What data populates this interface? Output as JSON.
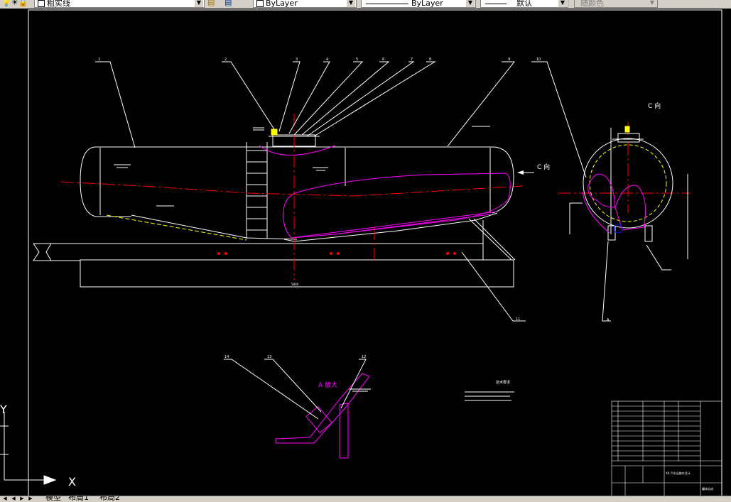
{
  "toolbar": {
    "layer_name": "粗实线",
    "color": "ByLayer",
    "linetype": "ByLayer",
    "lineweight": "默认",
    "plotstyle": "随颜色"
  },
  "drawing": {
    "balloons": [
      "1",
      "2",
      "3",
      "4",
      "5",
      "6",
      "7",
      "8",
      "9",
      "10",
      "11",
      "12",
      "13",
      "14"
    ],
    "view_label": "C 向",
    "view_arrow": "C 向",
    "detail_label": "A",
    "section_label": "A",
    "detail_title": "A 放大",
    "notes_title": "技术要求",
    "ucs_x": "X",
    "ucs_y": "Y",
    "title_block_company": "XX 汽车运输车设计",
    "title_block_name": "罐体总成"
  },
  "tabs": {
    "model": "模型",
    "layout1": "布局1",
    "layout2": "布局2"
  },
  "colors": {
    "canvas": "#000000",
    "line_white": "#ffffff",
    "center_red": "#ff0000",
    "magenta": "#ff00ff",
    "yellow": "#ffff00",
    "blue": "#0000ff"
  }
}
